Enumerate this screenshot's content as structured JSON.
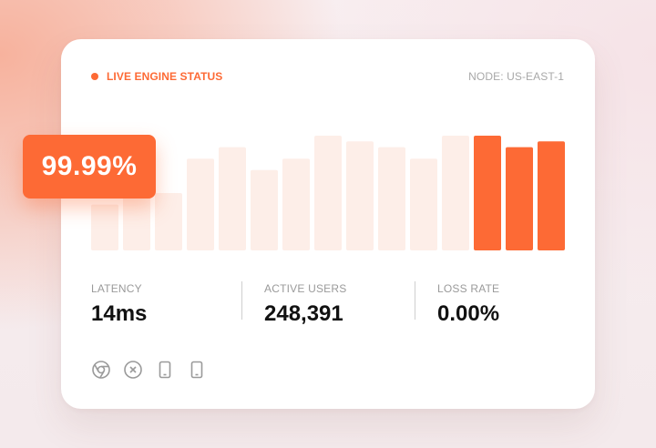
{
  "header": {
    "status_label": "LIVE ENGINE STATUS",
    "node_label": "NODE: US-EAST-1"
  },
  "badge": {
    "uptime": "99.99%"
  },
  "metrics": [
    {
      "label": "LATENCY",
      "value": "14ms"
    },
    {
      "label": "ACTIVE USERS",
      "value": "248,391"
    },
    {
      "label": "LOSS RATE",
      "value": "0.00%"
    }
  ],
  "icons": [
    "chrome-icon",
    "close-circle-icon",
    "tablet-icon",
    "tablet-icon"
  ],
  "colors": {
    "accent": "#fd6a35",
    "bar_inactive": "#fdeee8",
    "bar_active": "#fd6a35"
  },
  "chart_data": {
    "type": "bar",
    "values": [
      40,
      52,
      50,
      80,
      90,
      70,
      80,
      100,
      95,
      90,
      80,
      100,
      100,
      90,
      95
    ],
    "highlighted": [
      false,
      false,
      false,
      false,
      false,
      false,
      false,
      false,
      false,
      false,
      false,
      false,
      true,
      true,
      true
    ],
    "ylim": [
      0,
      100
    ]
  }
}
